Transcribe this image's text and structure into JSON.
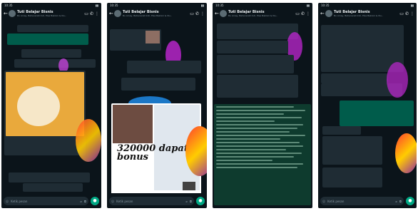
{
  "group": {
    "title": "Tuti Belajar Bisnis",
    "subtitle": "Bu Ainay, Bahenarati Indi, Elsa Bakoini & Nu..."
  },
  "statusbar": {
    "time": "10:35"
  },
  "composer": {
    "placeholder": "Ketik pesan"
  },
  "panel2": {
    "promo_text": "320000 dapat bonus"
  },
  "icons": {
    "back": "back-arrow-icon",
    "video": "video-call-icon",
    "call": "phone-call-icon",
    "menu": "more-vert-icon",
    "emoji": "emoji-icon",
    "attach": "attach-icon",
    "camera": "camera-icon",
    "mic": "mic-icon"
  },
  "colors": {
    "background": "#0b141a",
    "incoming": "#1f2c34",
    "outgoing": "#005c4b",
    "accent": "#00a884"
  }
}
